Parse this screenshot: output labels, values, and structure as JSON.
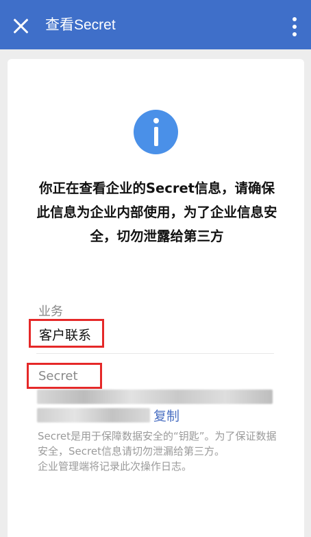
{
  "topbar": {
    "title": "查看Secret",
    "close_icon": "close-icon",
    "more_icon": "more-vertical-icon",
    "color": "#3f6fc9"
  },
  "notice": {
    "icon": "info-icon",
    "text": "你正在查看企业的Secret信息，请确保此信息为企业内部使用，为了企业信息安全，切勿泄露给第三方"
  },
  "business": {
    "label": "业务",
    "value": "客户联系"
  },
  "secret": {
    "label": "Secret",
    "value_redacted": true,
    "copy_label": "复制"
  },
  "footnote": {
    "line1": "Secret是用于保障数据安全的“钥匙”。为了保证数据安全，Secret信息请切勿泄漏给第三方。",
    "line2": "企业管理端将记录此次操作日志。"
  },
  "colors": {
    "accent": "#3f6fc9",
    "info": "#4a90e8",
    "highlight": "#e52828"
  }
}
